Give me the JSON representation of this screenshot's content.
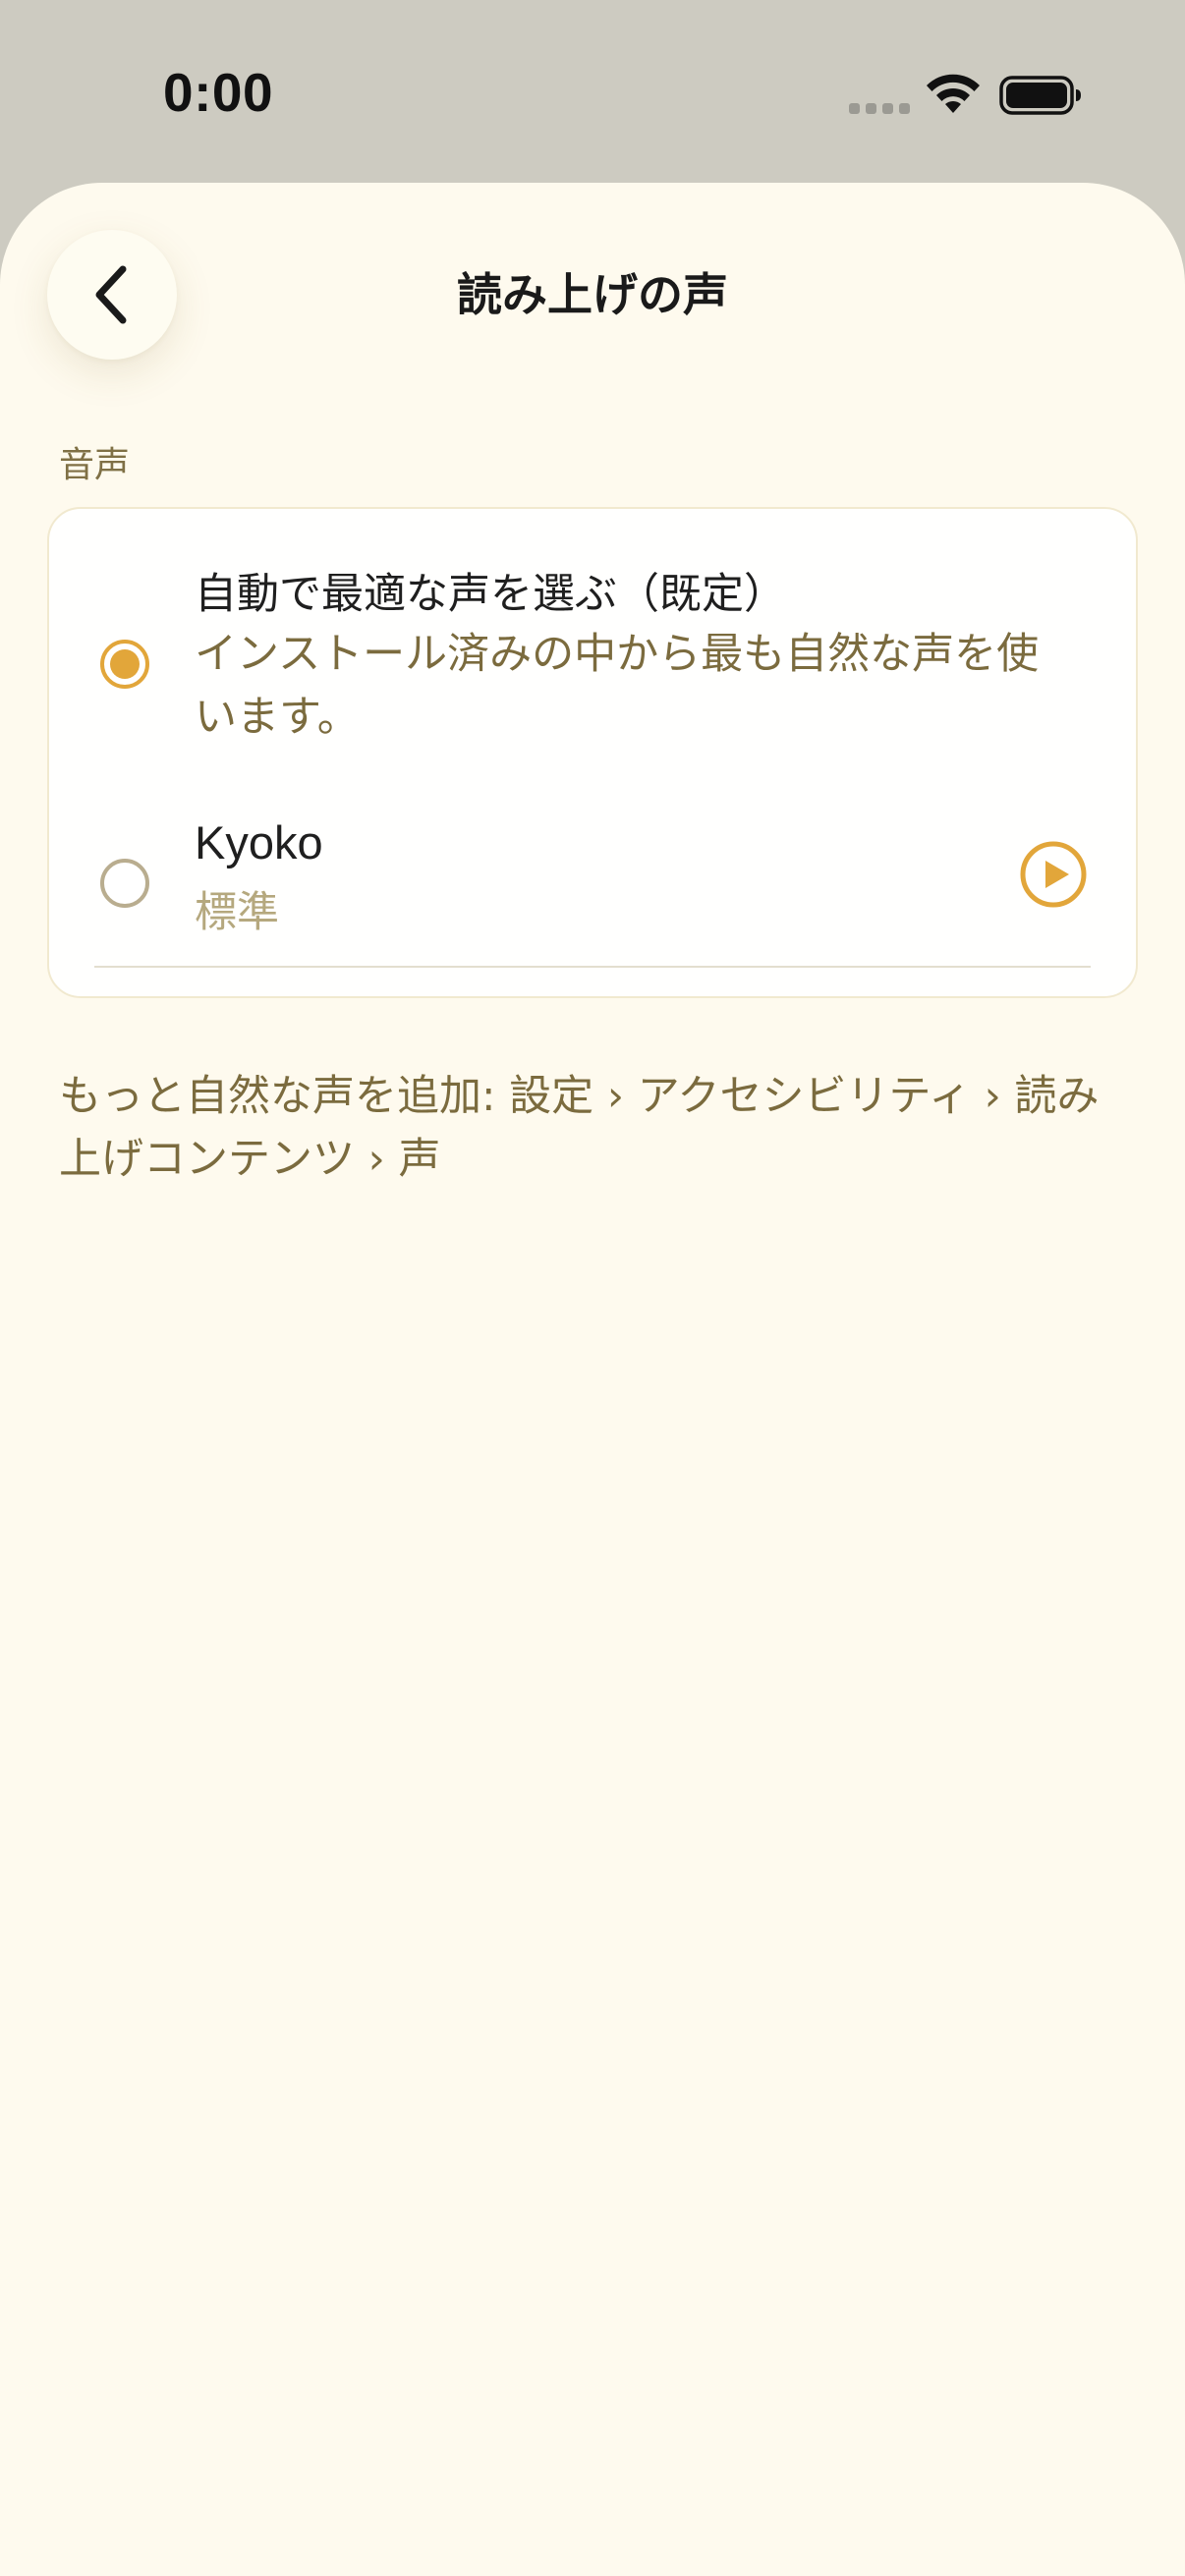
{
  "status_bar": {
    "time": "0:00"
  },
  "header": {
    "back_icon": "chevron-left-icon",
    "title": "読み上げの声"
  },
  "section": {
    "label": "音声"
  },
  "voice_options": [
    {
      "title": "自動で最適な声を選ぶ（既定）",
      "description": "インストール済みの中から最も自然な声を使います。",
      "selected": true
    },
    {
      "title": "Kyoko",
      "subtitle": "標準",
      "selected": false,
      "action_icon": "play-icon"
    }
  ],
  "footer": {
    "note": "もっと自然な声を追加: 設定 › アクセシビリティ › 読み上げコンテンツ › 声"
  },
  "colors": {
    "accent": "#E2A63A",
    "background": "#FEFAEE",
    "secondary_text": "#7B6B3E",
    "status_bar_bg": "#CDCBC1"
  }
}
